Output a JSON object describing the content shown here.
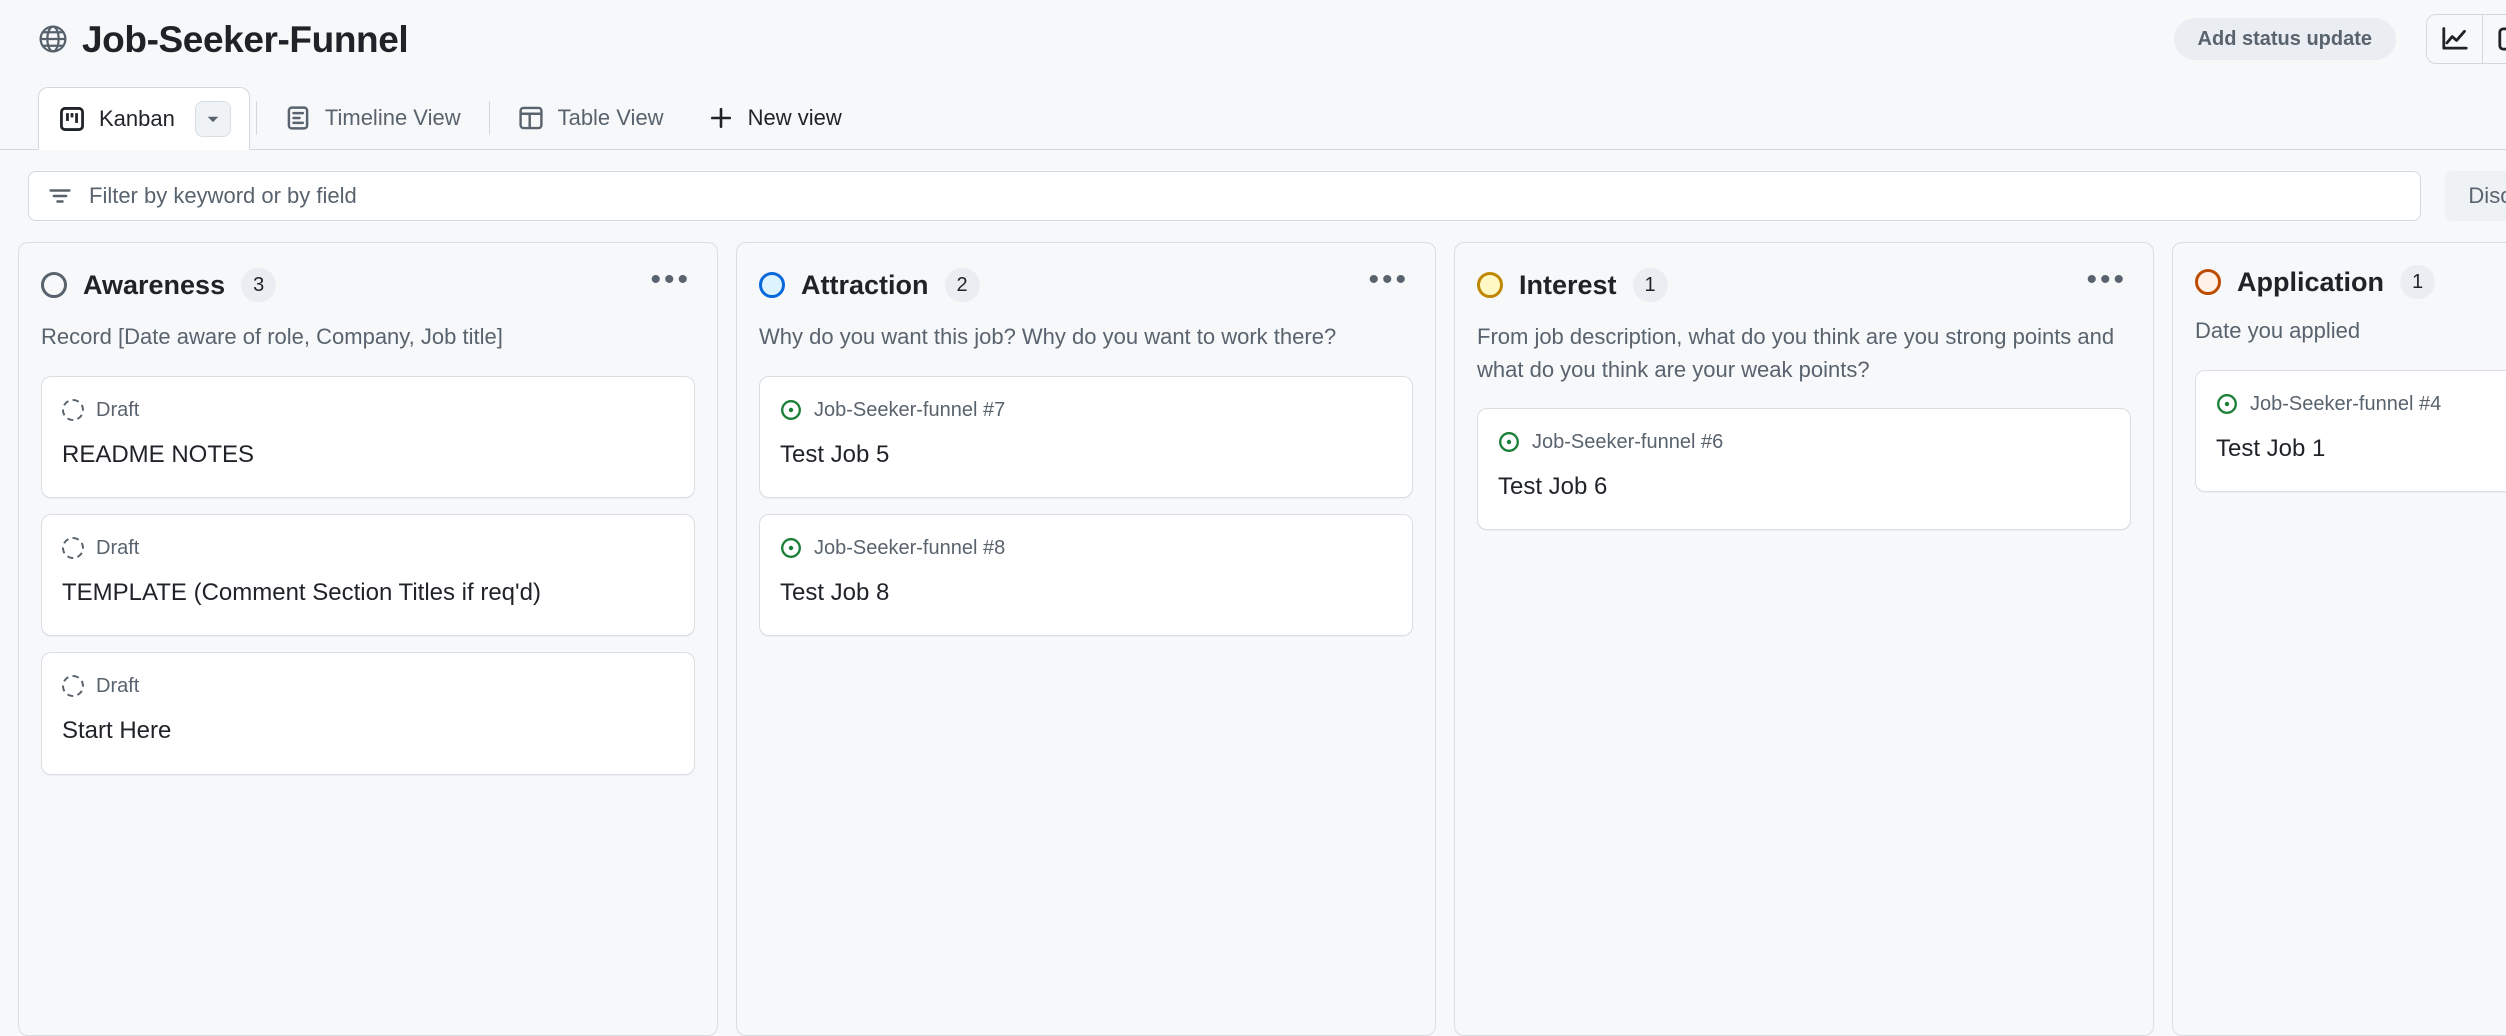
{
  "header": {
    "globe_icon": "globe-icon",
    "title": "Job-Seeker-Funnel",
    "status_update_label": "Add status update",
    "insights_icon": "line-chart-icon",
    "secondary_icon": "sidebar-panel-icon"
  },
  "tabs": {
    "items": [
      {
        "label": "Kanban",
        "icon": "kanban-board-icon",
        "active": true,
        "has_chevron": true
      },
      {
        "label": "Timeline View",
        "icon": "timeline-icon",
        "active": false,
        "has_chevron": false
      },
      {
        "label": "Table View",
        "icon": "table-icon",
        "active": false,
        "has_chevron": false
      }
    ],
    "new_view_label": "New view",
    "new_view_icon": "plus-icon"
  },
  "filter": {
    "icon": "filter-icon",
    "placeholder": "Filter by keyword or by field",
    "value": "",
    "discard_label": "Discard"
  },
  "board": {
    "columns": [
      {
        "name": "Awareness",
        "count": "3",
        "dot_color": "#59636e",
        "dot_fill": "transparent",
        "description": "Record [Date aware of role, Company, Job title]",
        "more_label": "•••",
        "cards": [
          {
            "meta": "Draft",
            "meta_type": "draft",
            "title": "README NOTES"
          },
          {
            "meta": "Draft",
            "meta_type": "draft",
            "title": "TEMPLATE (Comment Section Titles if req'd)"
          },
          {
            "meta": "Draft",
            "meta_type": "draft",
            "title": "Start Here"
          }
        ]
      },
      {
        "name": "Attraction",
        "count": "2",
        "dot_color": "#0969da",
        "dot_fill": "#ddf4ff",
        "description": "Why do you want this job? Why do you want to work there?",
        "more_label": "•••",
        "cards": [
          {
            "meta": "Job-Seeker-funnel #7",
            "meta_type": "issue",
            "title": "Test Job 5"
          },
          {
            "meta": "Job-Seeker-funnel #8",
            "meta_type": "issue",
            "title": "Test Job 8"
          }
        ]
      },
      {
        "name": "Interest",
        "count": "1",
        "dot_color": "#bf8700",
        "dot_fill": "#fff8c5",
        "description": "From job description, what do you think are you strong points and what do you think are your weak points?",
        "more_label": "•••",
        "cards": [
          {
            "meta": "Job-Seeker-funnel #6",
            "meta_type": "issue",
            "title": "Test Job 6"
          }
        ]
      },
      {
        "name": "Application",
        "count": "1",
        "dot_color": "#bc4c00",
        "dot_fill": "#fff1e5",
        "description": "Date you applied",
        "more_label": "",
        "cards": [
          {
            "meta": "Job-Seeker-funnel #4",
            "meta_type": "issue",
            "title": "Test Job 1"
          }
        ]
      }
    ]
  },
  "colors": {
    "page_bg": "#f6f8fa",
    "card_bg": "#ffffff",
    "border": "#d1d9e0",
    "text": "#1f2328",
    "muted_text": "#59636e",
    "issue_green": "#1a7f37"
  }
}
